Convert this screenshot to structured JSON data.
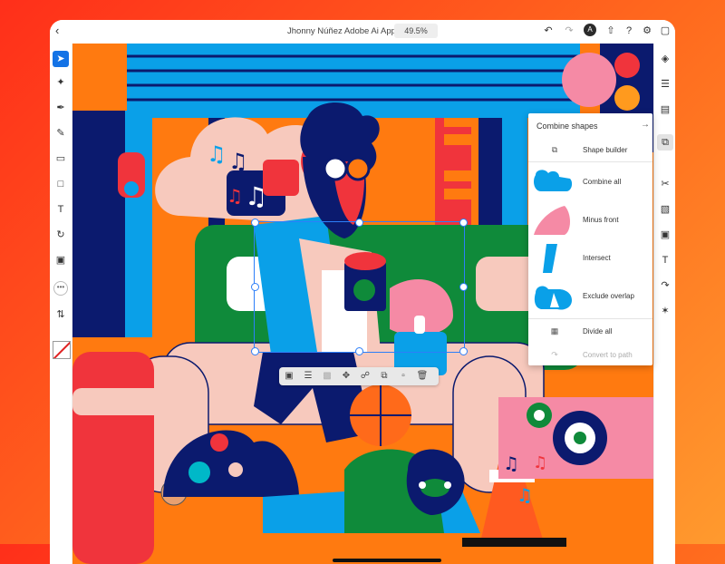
{
  "app": {
    "title": "Jhonny Núñez Adobe Ai App (1)",
    "zoom": "49.5%",
    "back_icon": "chevron-left-icon",
    "cloud_badge": "A"
  },
  "header_icons": [
    "undo-icon",
    "redo-icon",
    "cloud-user-icon",
    "share-icon",
    "help-icon",
    "settings-icon",
    "fit-screen-icon"
  ],
  "left_tools": [
    "selection-tool",
    "direct-selection-tool",
    "pen-tool",
    "pencil-tool",
    "eraser-tool",
    "rectangle-tool",
    "type-tool",
    "rotate-tool",
    "image-tool",
    "more-tool",
    "swap-tool",
    "color-swatch"
  ],
  "right_tools": [
    "layers-icon",
    "properties-icon",
    "library-icon",
    "combine-shapes-icon",
    "scissors-icon",
    "align-icon",
    "transform-icon",
    "type-icon",
    "path-icon",
    "symbol-icon"
  ],
  "context_bar": [
    "group-icon",
    "arrange-icon",
    "distribute-icon",
    "move-icon",
    "lock-icon",
    "duplicate-icon",
    "paste-icon",
    "delete-icon"
  ],
  "combine_panel": {
    "title": "Combine shapes",
    "items": [
      {
        "label": "Shape builder",
        "icon": "shape-builder-icon",
        "enabled": true
      },
      {
        "label": "Combine all",
        "icon": "combine-all-icon",
        "enabled": true
      },
      {
        "label": "Minus front",
        "icon": "minus-front-icon",
        "enabled": true
      },
      {
        "label": "Intersect",
        "icon": "intersect-icon",
        "enabled": true
      },
      {
        "label": "Exclude overlap",
        "icon": "exclude-overlap-icon",
        "enabled": true
      },
      {
        "label": "Divide all",
        "icon": "divide-all-icon",
        "enabled": true
      },
      {
        "label": "Convert to path",
        "icon": "convert-to-path-icon",
        "enabled": false
      }
    ]
  },
  "colors": {
    "accent": "#1473e6",
    "selection": "#2d7ff9",
    "artwork_orange": "#ff7a10",
    "artwork_blue": "#0aa0e8",
    "artwork_navy": "#0b1a6e",
    "artwork_pink": "#f7c9bd",
    "artwork_green": "#0f8a3a",
    "artwork_red": "#f0343c"
  }
}
